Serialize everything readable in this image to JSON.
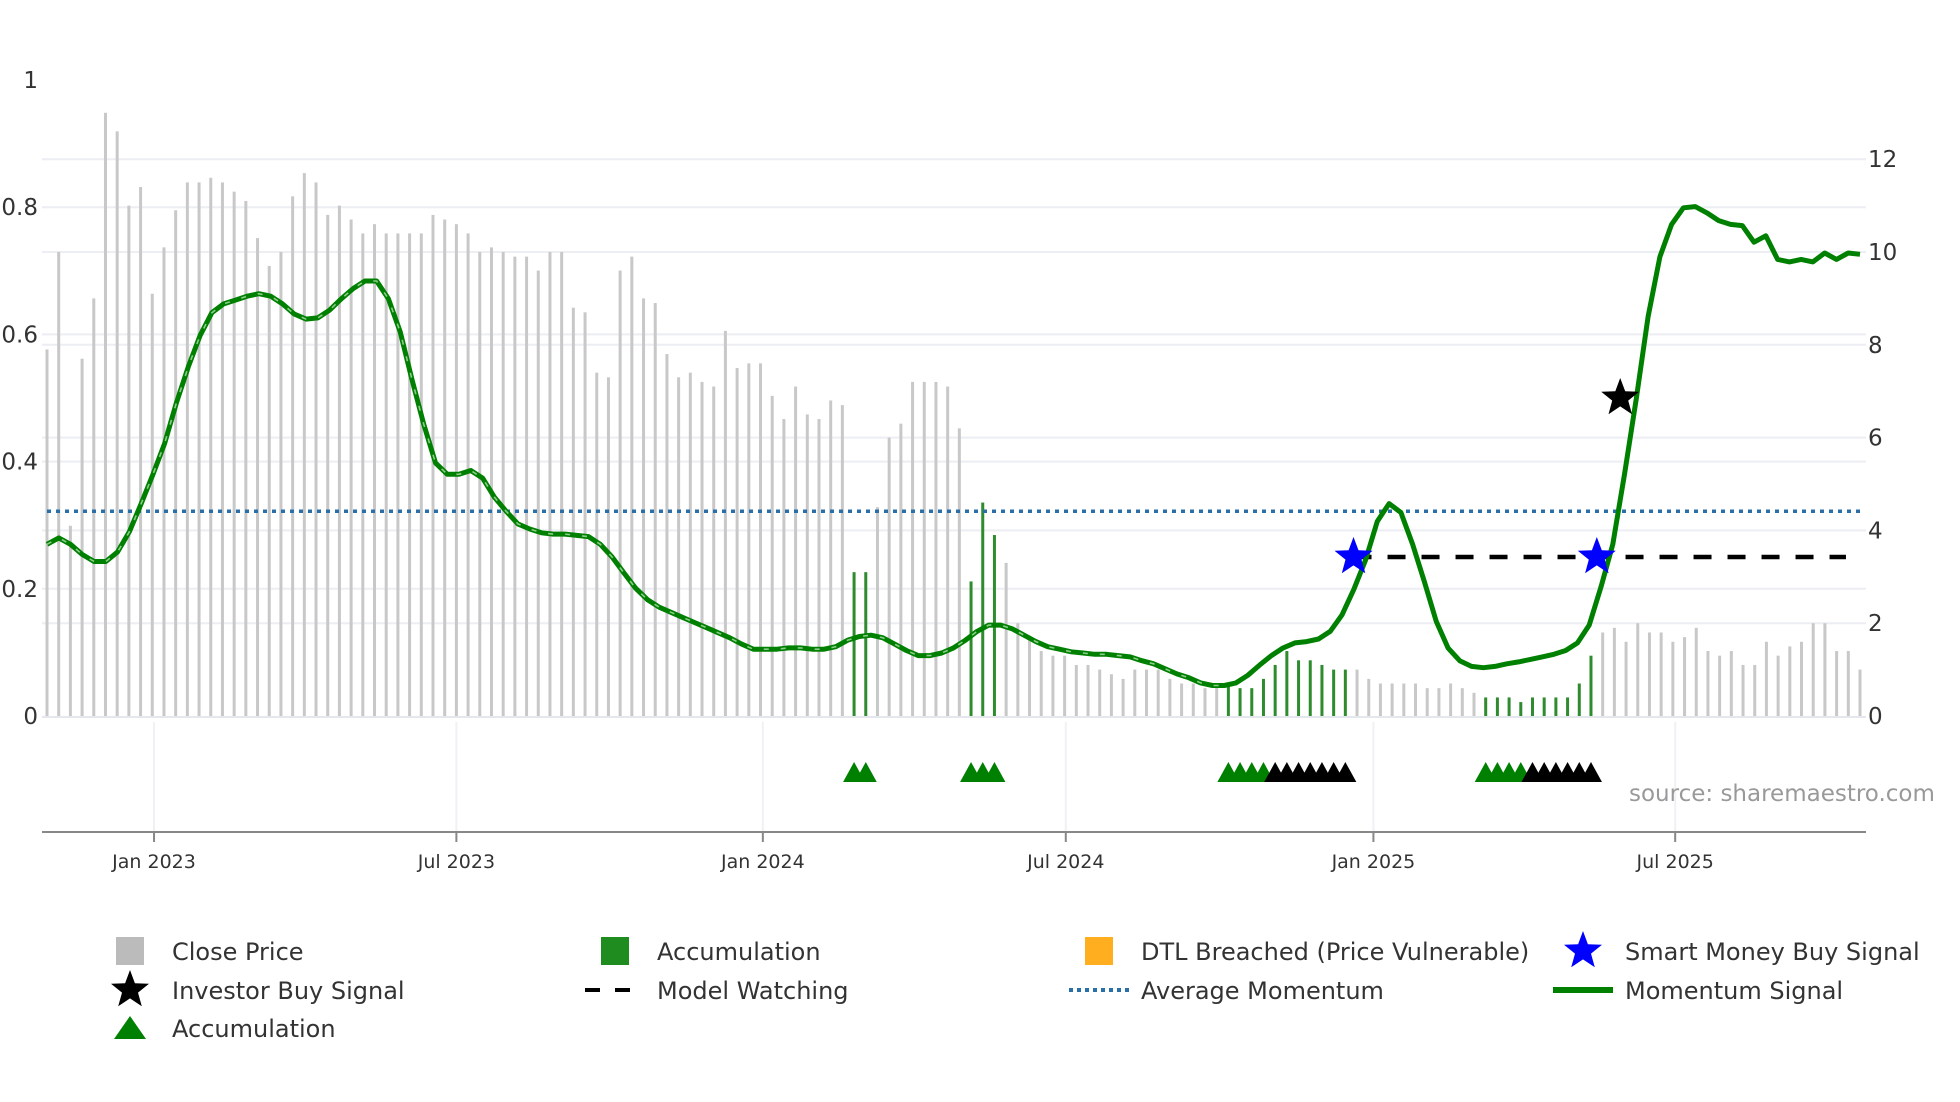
{
  "chart_data": {
    "type": "bar",
    "title": "",
    "x_axis": {
      "unit": "week index",
      "ticks": [
        {
          "label": "Jan 2023",
          "x": 9.15
        },
        {
          "label": "Jul 2023",
          "x": 35.0
        },
        {
          "label": "Jan 2024",
          "x": 61.2
        },
        {
          "label": "Jul 2024",
          "x": 87.1
        },
        {
          "label": "Jan 2025",
          "x": 113.4
        },
        {
          "label": "Jul 2025",
          "x": 139.2
        }
      ]
    },
    "y_left": {
      "range": [
        0,
        1
      ],
      "ticks": [
        "0",
        "0.2",
        "0.4",
        "0.6",
        "0.8",
        "1"
      ],
      "tick_values": [
        0,
        0.2,
        0.4,
        0.6,
        0.8,
        1
      ]
    },
    "y_right": {
      "range": [
        0,
        13.7
      ],
      "ticks": [
        "0",
        "2",
        "4",
        "6",
        "8",
        "10",
        "12"
      ],
      "tick_values": [
        0,
        2,
        4,
        6,
        8,
        10,
        12
      ]
    },
    "grid": true,
    "close_price": [
      7.9,
      10.0,
      4.1,
      7.7,
      9.0,
      13.0,
      12.6,
      11.0,
      11.4,
      9.1,
      10.1,
      10.9,
      11.5,
      11.5,
      11.6,
      11.5,
      11.3,
      11.1,
      10.3,
      9.7,
      10.0,
      11.2,
      11.7,
      11.5,
      10.8,
      11.0,
      10.7,
      10.4,
      10.6,
      10.4,
      10.4,
      10.4,
      10.4,
      10.8,
      10.7,
      10.6,
      10.4,
      10.0,
      10.1,
      10.0,
      9.9,
      9.9,
      9.6,
      10.0,
      10.0,
      8.8,
      8.7,
      7.4,
      7.3,
      9.6,
      9.9,
      9.0,
      8.9,
      7.8,
      7.3,
      7.4,
      7.2,
      7.1,
      8.3,
      7.5,
      7.6,
      7.6,
      6.9,
      6.4,
      7.1,
      6.5,
      6.4,
      6.8,
      6.7,
      3.1,
      3.1,
      4.5,
      6.0,
      6.3,
      7.2,
      7.2,
      7.2,
      7.1,
      6.2,
      2.9,
      4.6,
      3.9,
      3.3,
      2.0,
      1.7,
      1.4,
      1.3,
      1.3,
      1.1,
      1.1,
      1.0,
      0.9,
      0.8,
      1.0,
      1.0,
      1.0,
      0.8,
      0.7,
      0.7,
      0.6,
      0.7,
      0.7,
      0.6,
      0.6,
      0.8,
      1.1,
      1.4,
      1.2,
      1.2,
      1.1,
      1.0,
      1.0,
      1.0,
      0.8,
      0.7,
      0.7,
      0.7,
      0.7,
      0.6,
      0.6,
      0.7,
      0.6,
      0.5,
      0.4,
      0.4,
      0.4,
      0.3,
      0.4,
      0.4,
      0.4,
      0.4,
      0.7,
      1.3,
      1.8,
      1.9,
      1.6,
      2.0,
      1.8,
      1.8,
      1.6,
      1.7,
      1.9,
      1.4,
      1.3,
      1.4,
      1.1,
      1.1,
      1.6,
      1.3,
      1.5,
      1.6,
      2.0,
      2.0,
      1.4,
      1.4,
      1.0
    ],
    "accumulation_bar_indices": [
      69,
      70,
      79,
      80,
      81,
      101,
      102,
      103,
      104,
      105,
      106,
      107,
      108,
      109,
      110,
      111,
      123,
      124,
      125,
      126,
      127,
      128,
      129,
      130,
      131,
      132
    ],
    "momentum_signal": [
      0.27,
      0.28,
      0.27,
      0.254,
      0.243,
      0.243,
      0.258,
      0.29,
      0.334,
      0.38,
      0.429,
      0.493,
      0.549,
      0.598,
      0.634,
      0.648,
      0.654,
      0.66,
      0.664,
      0.66,
      0.648,
      0.632,
      0.624,
      0.626,
      0.638,
      0.656,
      0.672,
      0.684,
      0.684,
      0.656,
      0.604,
      0.529,
      0.459,
      0.398,
      0.38,
      0.38,
      0.386,
      0.374,
      0.344,
      0.322,
      0.302,
      0.294,
      0.288,
      0.286,
      0.286,
      0.284,
      0.282,
      0.27,
      0.25,
      0.225,
      0.201,
      0.183,
      0.171,
      0.163,
      0.155,
      0.147,
      0.139,
      0.131,
      0.123,
      0.113,
      0.105,
      0.105,
      0.105,
      0.107,
      0.107,
      0.105,
      0.105,
      0.109,
      0.119,
      0.125,
      0.127,
      0.123,
      0.113,
      0.103,
      0.095,
      0.095,
      0.099,
      0.107,
      0.119,
      0.133,
      0.143,
      0.143,
      0.137,
      0.127,
      0.117,
      0.109,
      0.105,
      0.101,
      0.099,
      0.097,
      0.097,
      0.095,
      0.093,
      0.087,
      0.082,
      0.074,
      0.066,
      0.06,
      0.052,
      0.048,
      0.048,
      0.052,
      0.064,
      0.08,
      0.095,
      0.107,
      0.115,
      0.117,
      0.121,
      0.133,
      0.159,
      0.199,
      0.245,
      0.306,
      0.334,
      0.32,
      0.27,
      0.211,
      0.149,
      0.107,
      0.087,
      0.078,
      0.076,
      0.078,
      0.082,
      0.085,
      0.089,
      0.093,
      0.097,
      0.103,
      0.115,
      0.143,
      0.203,
      0.27,
      0.38,
      0.499,
      0.628,
      0.722,
      0.773,
      0.799,
      0.801,
      0.791,
      0.779,
      0.773,
      0.771,
      0.745,
      0.755,
      0.718,
      0.714,
      0.718,
      0.714,
      0.728,
      0.718,
      0.728,
      0.726
    ],
    "momentum_dashed_until_index": 100,
    "average_momentum": 0.322,
    "model_watching": {
      "value": 0.25,
      "from": 111.7,
      "to": 153.8
    },
    "smart_money_buy_signals": [
      {
        "x": 111.7,
        "y": 0.25
      },
      {
        "x": 132.5,
        "y": 0.25
      }
    ],
    "investor_buy_signals": [
      {
        "x": 134.5,
        "y": 0.5
      }
    ],
    "accumulation_triangles": {
      "green": [
        69,
        70,
        79,
        80,
        81,
        101,
        102,
        103,
        104,
        123,
        124,
        125,
        126
      ],
      "black": [
        105,
        106,
        107,
        108,
        109,
        110,
        111,
        127,
        128,
        129,
        130,
        131,
        132
      ]
    },
    "legend": {
      "placement": "bottom",
      "items": [
        {
          "label": "Close Price",
          "marker": "square",
          "color": "#bbbbbb"
        },
        {
          "label": "Accumulation",
          "marker": "square",
          "color": "#1e8c1e"
        },
        {
          "label": "DTL Breached (Price Vulnerable)",
          "marker": "square",
          "color": "#ffae1f"
        },
        {
          "label": "Smart Money Buy Signal",
          "marker": "star",
          "color": "#0000ff"
        },
        {
          "label": "Investor Buy Signal",
          "marker": "star",
          "color": "#000000"
        },
        {
          "label": "Model Watching",
          "marker": "dash",
          "color": "#000000"
        },
        {
          "label": "Average Momentum",
          "marker": "dot",
          "color": "#2a6fa8"
        },
        {
          "label": "Momentum Signal",
          "marker": "line",
          "color": "#008000"
        },
        {
          "label": "Accumulation",
          "marker": "triangle",
          "color": "#008000"
        }
      ]
    },
    "annotation": "source: sharemaestro.com"
  },
  "colors": {
    "price": "#c8c8c8",
    "accum_bar": "#2e8b2e",
    "momentum": "#008000",
    "avg": "#2a6fa8",
    "grid": "#eceef3",
    "axis": "#888888"
  }
}
